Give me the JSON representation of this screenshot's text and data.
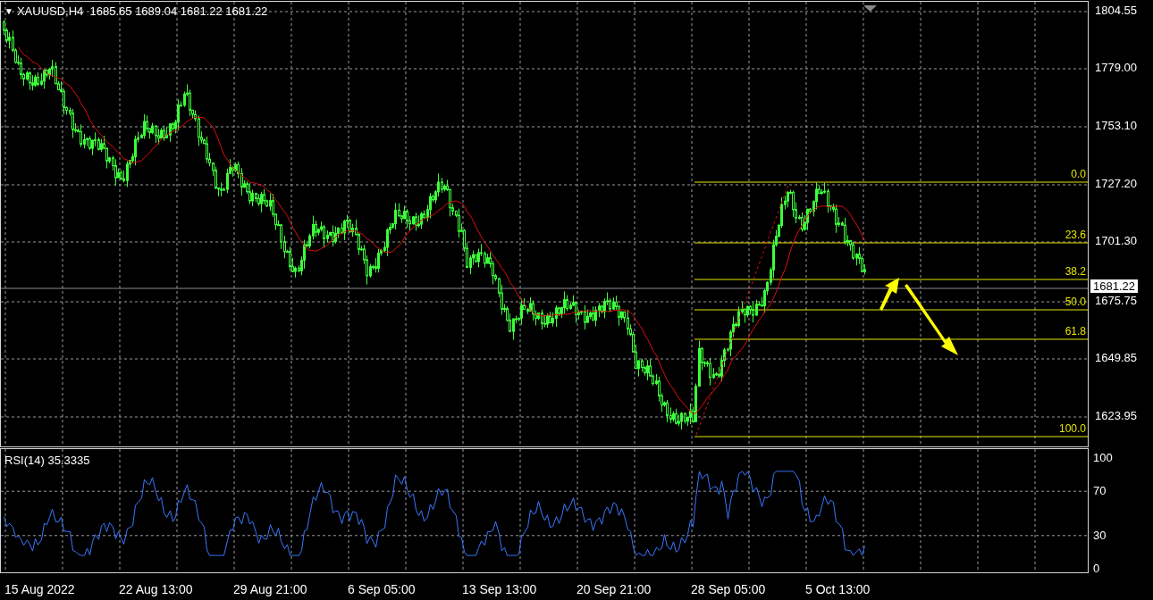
{
  "chart_header": {
    "collapse_glyph": "▼",
    "title": "XAUUSD,H4  1685.65 1689.04 1681.22 1681.22"
  },
  "price_axis": [
    "1804.55",
    "1779.00",
    "1753.10",
    "1727.20",
    "1701.30",
    "1675.75",
    "1649.85",
    "1623.95"
  ],
  "current_price": "1681.22",
  "fibonacci_levels": [
    "0.0",
    "23.6",
    "38.2",
    "50.0",
    "61.8",
    "100.0"
  ],
  "indicator": {
    "label": "RSI(14) 35.3335",
    "axis": [
      "100",
      "70",
      "30",
      "0"
    ]
  },
  "time_axis": [
    "15 Aug 2022",
    "22 Aug 13:00",
    "29 Aug 21:00",
    "6 Sep 05:00",
    "13 Sep 13:00",
    "20 Sep 21:00",
    "28 Sep 05:00",
    "5 Oct 13:00"
  ]
}
